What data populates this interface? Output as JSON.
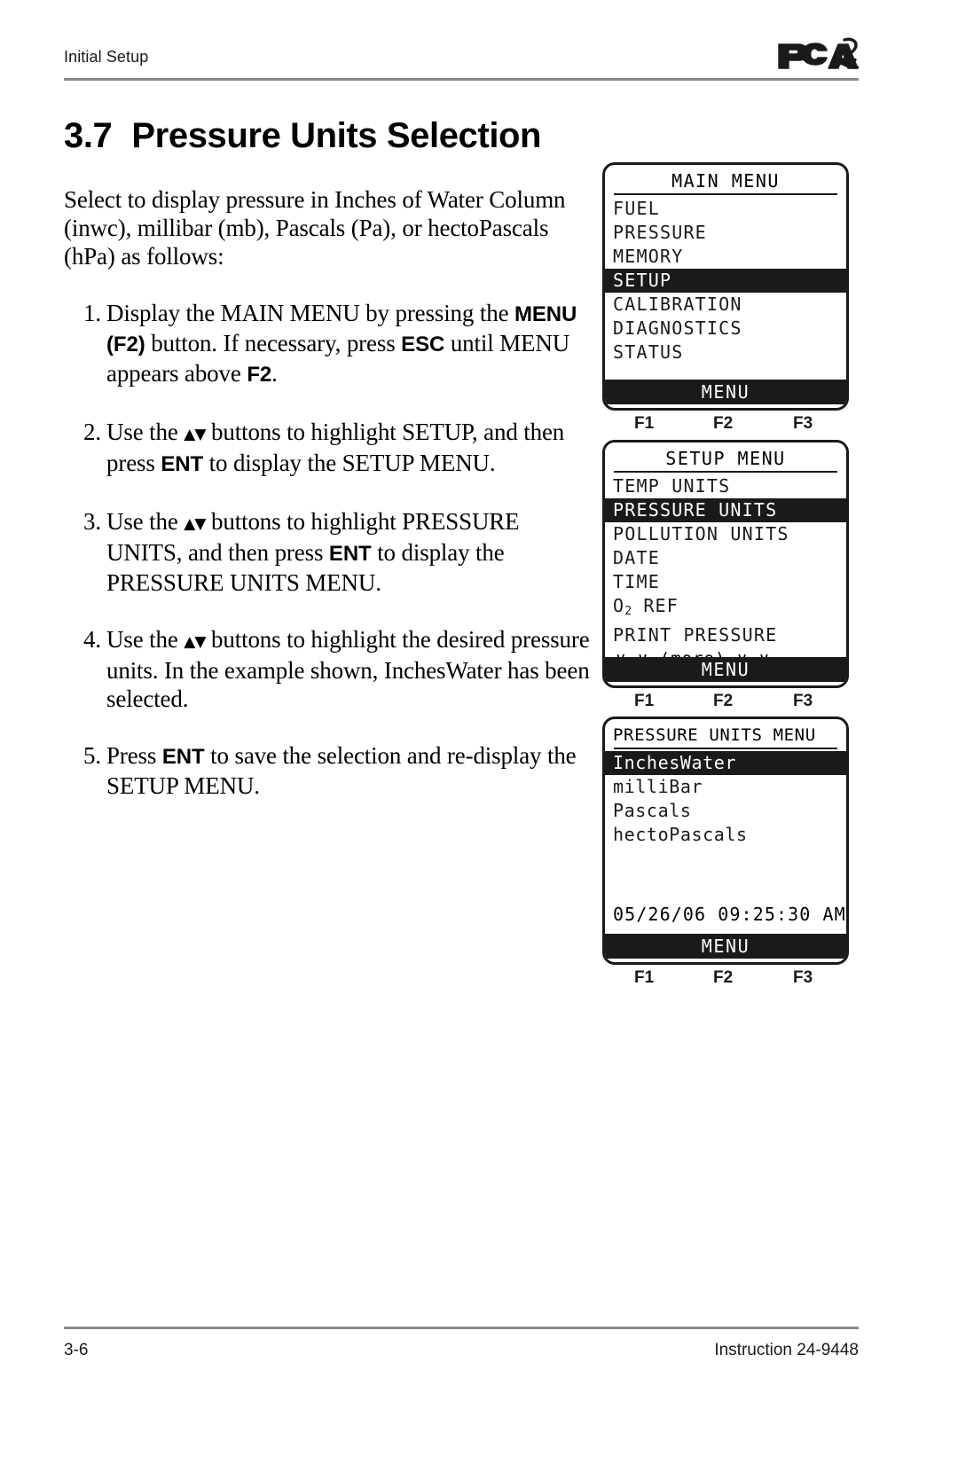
{
  "header": {
    "running_head": "Initial Setup",
    "logo_text": "PCA",
    "logo_superscript": "2"
  },
  "section": {
    "number": "3.7",
    "title": "Pressure Units Selection"
  },
  "intro": {
    "line1": "Select to display pressure in Inches of Water",
    "line2": "Column (inwc), millibar (mb), Pascals (Pa), or",
    "line3": "hectoPascals (hPa) as follows:"
  },
  "steps": [
    {
      "marker": "1.",
      "parts": [
        {
          "t": "Display the MAIN MENU by pressing the ",
          "s": "normal"
        },
        {
          "t": "MENU (F2)",
          "s": "bold"
        },
        {
          "t": " button. If necessary, press ",
          "s": "normal"
        },
        {
          "t": "ESC",
          "s": "bold"
        },
        {
          "t": " until MENU appears above ",
          "s": "normal"
        },
        {
          "t": "F2",
          "s": "bold"
        },
        {
          "t": ".",
          "s": "normal"
        }
      ]
    },
    {
      "marker": "2.",
      "parts": [
        {
          "t": "Use the ",
          "s": "normal"
        },
        {
          "t": "▲▼",
          "s": "arrows"
        },
        {
          "t": " buttons to highlight SETUP, and then press ",
          "s": "normal"
        },
        {
          "t": "ENT",
          "s": "bold"
        },
        {
          "t": " to display the SETUP MENU.",
          "s": "normal"
        }
      ]
    },
    {
      "marker": "3.",
      "parts": [
        {
          "t": "Use the ",
          "s": "normal"
        },
        {
          "t": "▲▼",
          "s": "arrows"
        },
        {
          "t": " buttons to highlight PRESSURE UNITS, and then press ",
          "s": "normal"
        },
        {
          "t": "ENT",
          "s": "bold"
        },
        {
          "t": " to display the PRESSURE UNITS MENU.",
          "s": "normal"
        }
      ]
    },
    {
      "marker": "4.",
      "parts": [
        {
          "t": "Use the ",
          "s": "normal"
        },
        {
          "t": "▲▼",
          "s": "arrows"
        },
        {
          "t": " buttons to highlight the desired pressure units. In the example shown, InchesWater has been selected.",
          "s": "normal"
        }
      ]
    },
    {
      "marker": "5.",
      "parts": [
        {
          "t": "Press ",
          "s": "normal"
        },
        {
          "t": "ENT",
          "s": "bold"
        },
        {
          "t": " to save the selection and re-display the SETUP MENU.",
          "s": "normal"
        }
      ]
    }
  ],
  "screens": [
    {
      "id": "main-menu",
      "title": "MAIN MENU",
      "title_align": "center",
      "items": [
        {
          "label": "FUEL",
          "highlighted": false
        },
        {
          "label": "PRESSURE",
          "highlighted": false
        },
        {
          "label": "MEMORY",
          "highlighted": false
        },
        {
          "label": "SETUP",
          "highlighted": true
        },
        {
          "label": "CALIBRATION",
          "highlighted": false
        },
        {
          "label": "DIAGNOSTICS",
          "highlighted": false
        },
        {
          "label": "STATUS",
          "highlighted": false
        }
      ],
      "more_row": null,
      "timestamp": null,
      "softkey_label": "MENU",
      "fkeys": [
        "F1",
        "F2",
        "F3"
      ]
    },
    {
      "id": "setup-menu",
      "title": "SETUP MENU",
      "title_align": "center",
      "items": [
        {
          "label": "TEMP UNITS",
          "highlighted": false
        },
        {
          "label": "PRESSURE UNITS",
          "highlighted": true
        },
        {
          "label": "POLLUTION UNITS",
          "highlighted": false
        },
        {
          "label": "DATE",
          "highlighted": false
        },
        {
          "label": "TIME",
          "highlighted": false
        },
        {
          "label": "O2 REF",
          "highlighted": false,
          "subscript": "2",
          "prefix": "O",
          "suffix": " REF"
        },
        {
          "label": "PRINT PRESSURE",
          "highlighted": false
        }
      ],
      "more_row": "∨ ∨  (more)  ∨ ∨",
      "timestamp": null,
      "softkey_label": "MENU",
      "fkeys": [
        "F1",
        "F2",
        "F3"
      ]
    },
    {
      "id": "pressure-units-menu",
      "title": "PRESSURE UNITS MENU",
      "title_align": "left",
      "items": [
        {
          "label": "InchesWater",
          "highlighted": true
        },
        {
          "label": "milliBar",
          "highlighted": false
        },
        {
          "label": "Pascals",
          "highlighted": false
        },
        {
          "label": "hectoPascals",
          "highlighted": false
        }
      ],
      "more_row": null,
      "timestamp": "05/26/06 09:25:30 AM",
      "softkey_label": "MENU",
      "fkeys": [
        "F1",
        "F2",
        "F3"
      ]
    }
  ],
  "footer": {
    "page_number": "3-6",
    "instruction": "Instruction 24-9448"
  },
  "colors": {
    "ink": "#1a1a1a",
    "rule": "#8a8a8a",
    "highlight_bg": "#1a1a1a",
    "highlight_fg": "#ffffff",
    "page_bg": "#ffffff"
  }
}
